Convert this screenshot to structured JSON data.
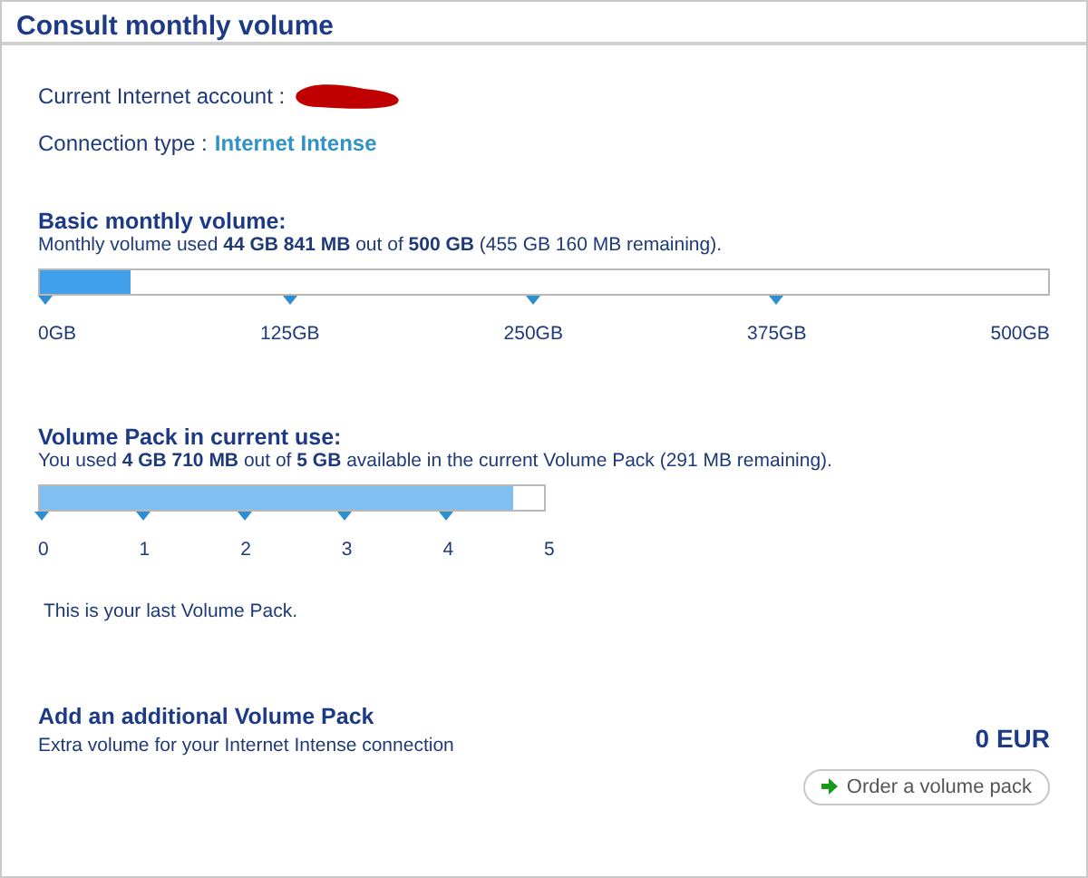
{
  "title": "Consult monthly volume",
  "account": {
    "label": "Current Internet account :"
  },
  "connection": {
    "label": "Connection type :",
    "value": "Internet Intense"
  },
  "basic_volume": {
    "heading": "Basic monthly volume:",
    "summary": "Monthly volume used **44 GB 841 MB** out of **500 GB**  (455 GB 160 MB remaining).",
    "level": 0.09,
    "ticks": [
      {
        "label": "0GB",
        "marker": true
      },
      {
        "label": "125GB",
        "marker": true
      },
      {
        "label": "250GB",
        "marker": true
      },
      {
        "label": "375GB",
        "marker": true
      },
      {
        "label": "500GB",
        "marker": false
      }
    ]
  },
  "volume_pack": {
    "heading": "Volume Pack in current use:",
    "summary": "You used **4 GB 710 MB** out of **5 GB** available in the current Volume Pack (291 MB remaining).",
    "level": 0.94,
    "ticks": [
      {
        "label": "0",
        "marker": true
      },
      {
        "label": "1",
        "marker": true
      },
      {
        "label": "2",
        "marker": true
      },
      {
        "label": "3",
        "marker": true
      },
      {
        "label": "4",
        "marker": true
      },
      {
        "label": "5",
        "marker": false
      }
    ],
    "note": "This is your last Volume Pack."
  },
  "additional_pack": {
    "heading": "Add an additional Volume Pack",
    "description": "Extra volume for your Internet Intense connection",
    "price": "0 EUR",
    "button": "Order a volume pack"
  }
}
